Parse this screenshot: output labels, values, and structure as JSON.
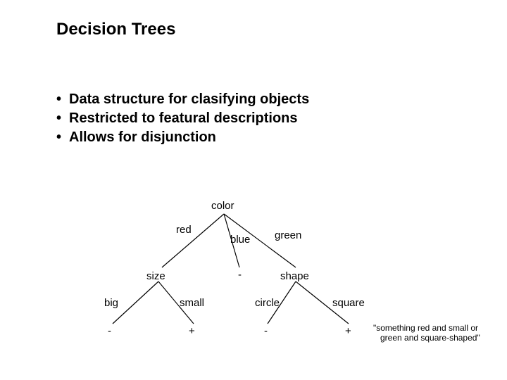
{
  "title": "Decision Trees",
  "bullets": [
    "Data structure for clasifying objects",
    "Restricted to featural descriptions",
    "Allows for disjunction"
  ],
  "tree": {
    "root": "color",
    "edges1": {
      "left": "red",
      "mid": "blue",
      "right": "green"
    },
    "mid_leaf": "-",
    "left_node": "size",
    "right_node": "shape",
    "left_edges": {
      "left": "big",
      "right": "small"
    },
    "right_edges": {
      "left": "circle",
      "right": "square"
    },
    "leaves": {
      "big": "-",
      "small": "+",
      "circle": "-",
      "square": "+"
    }
  },
  "caption_line1": "\"something red and small or",
  "caption_line2": "green and square-shaped\""
}
